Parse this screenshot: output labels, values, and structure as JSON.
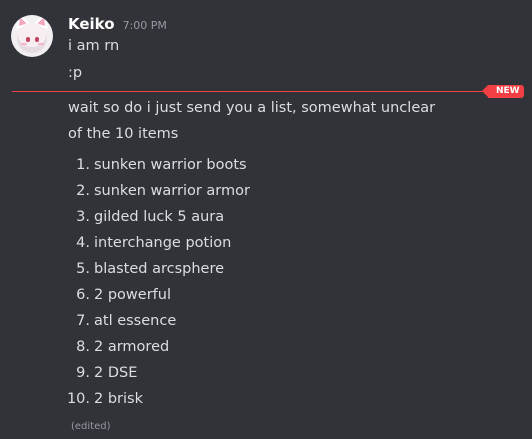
{
  "message": {
    "username": "Keiko",
    "timestamp": "7:00 PM",
    "lines": [
      "i am rn",
      ":p"
    ],
    "new_badge": "NEW",
    "paragraph": [
      "wait so do i just send you a list, somewhat unclear",
      "of the 10 items"
    ],
    "list_items": [
      {
        "num": "1.",
        "text": "sunken warrior boots"
      },
      {
        "num": "2.",
        "text": "sunken warrior armor"
      },
      {
        "num": "3.",
        "text": "gilded luck 5 aura"
      },
      {
        "num": "4.",
        "text": "interchange potion"
      },
      {
        "num": "5.",
        "text": "blasted arcsphere"
      },
      {
        "num": "6.",
        "text": "2 powerful"
      },
      {
        "num": "7.",
        "text": "atl essence"
      },
      {
        "num": "8.",
        "text": "2 armored"
      },
      {
        "num": "9.",
        "text": "2 DSE"
      },
      {
        "num": "10.",
        "text": "2 brisk"
      }
    ],
    "edited": "(edited)"
  },
  "colors": {
    "background": "#323339",
    "new_divider": "#f23f43",
    "username": "#ffffff",
    "text": "#dbdee1",
    "muted": "#949ba4"
  },
  "icons": {
    "avatar": "cat-ear-anime-avatar"
  }
}
